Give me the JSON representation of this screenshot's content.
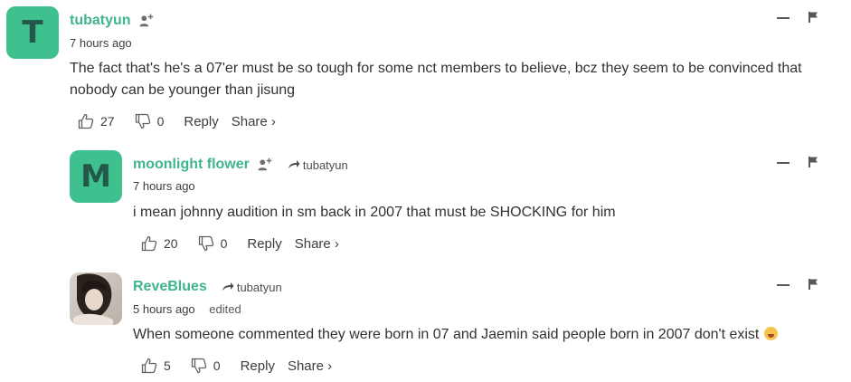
{
  "comments": [
    {
      "avatar_letter": "T",
      "avatar_color": "#3fc08f",
      "author": "tubatyun",
      "time": "7 hours ago",
      "edited": "",
      "reply_to": "",
      "text": "The fact that's he's a 07'er must be so tough for some nct members to believe, bcz they seem to be convinced that nobody can be younger than jisung",
      "likes": "27",
      "dislikes": "0",
      "reply_label": "Reply",
      "share_label": "Share ›"
    },
    {
      "avatar_letter": "M",
      "avatar_color": "#3fc08f",
      "author": "moonlight flower",
      "time": "7 hours ago",
      "edited": "",
      "reply_to": "tubatyun",
      "text": "i mean johnny audition in sm back in 2007 that must be SHOCKING for him",
      "likes": "20",
      "dislikes": "0",
      "reply_label": "Reply",
      "share_label": "Share ›"
    },
    {
      "avatar_letter": "",
      "avatar_color": "",
      "author": "ReveBlues",
      "time": "5 hours ago",
      "edited": "edited",
      "reply_to": "tubatyun",
      "text": "When someone commented they were born in 07 and Jaemin said people born in 2007 don't exist",
      "likes": "5",
      "dislikes": "0",
      "reply_label": "Reply",
      "share_label": "Share ›"
    }
  ],
  "icons": {
    "follow": "user-plus-icon",
    "reply_arrow": "reply-arrow-icon",
    "upvote": "thumbs-up-icon",
    "downvote": "thumbs-down-icon",
    "minimize": "minimize-icon",
    "flag": "flag-icon",
    "emoji": "crying-face-emoji"
  },
  "colors": {
    "author": "#3fb58a",
    "text": "#2f3234",
    "avatar_text": "#1f4a3a"
  }
}
